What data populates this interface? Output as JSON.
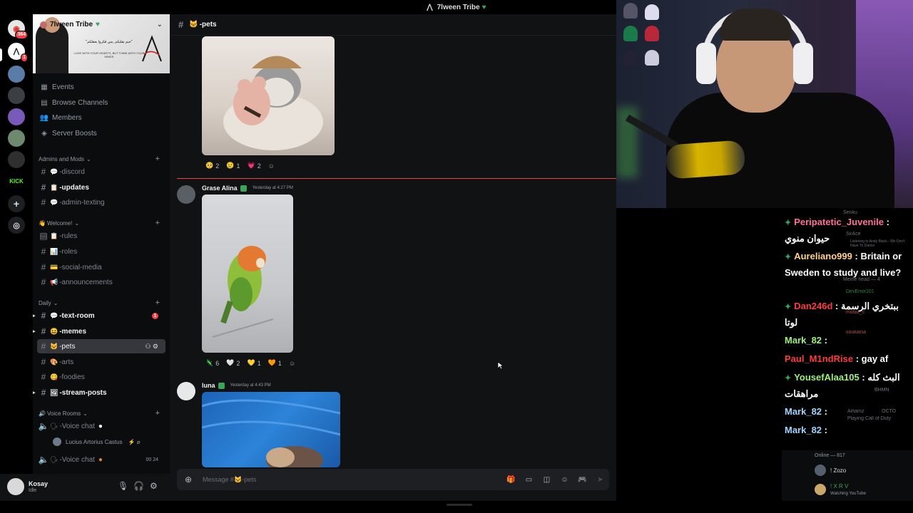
{
  "window": {
    "title": "7lween Tribe"
  },
  "rail": {
    "servers": [
      {
        "name": "server-1",
        "color": "#e6e6e6",
        "badge": "364"
      },
      {
        "name": "server-2",
        "color": "#ffffff",
        "badge": "1"
      },
      {
        "name": "server-3",
        "color": "#5a7ca8"
      },
      {
        "name": "server-4",
        "color": "#3b3f44"
      },
      {
        "name": "server-5",
        "color": "#7a5ab8"
      },
      {
        "name": "server-6",
        "color": "#6d8a6e"
      },
      {
        "name": "server-7",
        "color": "#2f2f2f"
      },
      {
        "name": "server-8",
        "color": "#53fc18",
        "label": "KICK"
      }
    ]
  },
  "sidebar": {
    "server_name": "7lween Tribe",
    "banner_tagline": "\"خبم بقلبكم ,بس فكروا بعقلكم\"",
    "banner_slogan": "LOVE WITH YOUR HEARTS, BUT THINK WITH YOUR MINDS",
    "nav": [
      {
        "label": "Events",
        "icon": "calendar-icon"
      },
      {
        "label": "Browse Channels",
        "icon": "browse-icon"
      },
      {
        "label": "Members",
        "icon": "members-icon"
      },
      {
        "label": "Server Boosts",
        "icon": "boost-icon"
      }
    ],
    "categories": {
      "admins": "Admins and Mods",
      "welcome": "Welcome!",
      "daily": "Daily",
      "voice": "Voice Rooms"
    },
    "channels": {
      "discord": "-discord",
      "updates": "-updates",
      "admin_texting": "-admin-texting",
      "rules": "-rules",
      "roles": "-roles",
      "social_media": "-social-media",
      "announcements": "-announcements",
      "text_room": "-text-room",
      "text_room_badge": "1",
      "memes": "-memes",
      "pets": "-pets",
      "arts": "-arts",
      "foodies": "-foodies",
      "stream_posts": "-stream-posts",
      "voice_chat_1": "-Voice chat",
      "voice_chat_2": "-Voice chat",
      "voice_chat_2_count_a": "00",
      "voice_chat_2_count_b": "24"
    },
    "voice_user": "Lucius Artorius Castus"
  },
  "user_panel": {
    "name": "Kosay",
    "status": "Idle"
  },
  "chat": {
    "channel": "-pets",
    "messages": [
      {
        "reactions": [
          {
            "emoji": "🥺",
            "count": "2"
          },
          {
            "emoji": "😢",
            "count": "1"
          },
          {
            "emoji": "💗",
            "count": "2"
          }
        ]
      },
      {
        "author": "Grase Alina",
        "time": "Yesterday at 4:27 PM",
        "reactions": [
          {
            "emoji": "🦎",
            "count": "6"
          },
          {
            "emoji": "🤍",
            "count": "2"
          },
          {
            "emoji": "💛",
            "count": "1"
          },
          {
            "emoji": "🧡",
            "count": "1"
          }
        ]
      },
      {
        "author": "luna",
        "time": "Yesterday at 4:43 PM"
      }
    ],
    "composer_placeholder": "Message #🐱-pets"
  },
  "stream_chat": {
    "lines": [
      {
        "user": "Peripatetic_Juvenile",
        "text": ":",
        "text2": "حيوان منوي"
      },
      {
        "user": "Aureliano999",
        "text": ": Britain or Sweden to study and live?"
      },
      {
        "user": "Dan246d",
        "text": ": ببتخري الرسمة",
        "text2": "لوتا"
      },
      {
        "user": "Mark_82",
        "text": ":"
      },
      {
        "user": "Paul_M1ndRise",
        "text": ": gay af"
      },
      {
        "user": "YousefAlaa105",
        "text": ": البث كله",
        "text2": "مراهقات"
      },
      {
        "user": "Mark_82",
        "text": ":"
      },
      {
        "user": "Mark_82",
        "text": ":"
      }
    ],
    "ghost": {
      "g1": "Senku",
      "g2": "SirAce",
      "g3": "Listening to Andy Black - We Don't Have To Dance",
      "g4": "Meme head — 4",
      "g5": "DevError101",
      "g6": "motaz_c",
      "g7": "soukaina",
      "g8": "Aihamz",
      "g9": "BHMN",
      "g10": "Playing Call of Duty",
      "g11": "OCTO"
    }
  },
  "members": {
    "header": "Online — 817",
    "list": [
      {
        "name": "! Zozo",
        "sub": ""
      },
      {
        "name": "! X R V",
        "sub": "Watching YouTube"
      }
    ]
  }
}
